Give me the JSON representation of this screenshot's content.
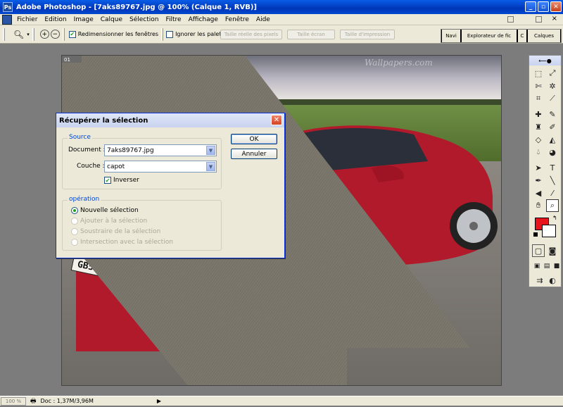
{
  "window": {
    "title": "Adobe Photoshop - [7aks89767.jpg @ 100% (Calque 1, RVB)]"
  },
  "menu": [
    "Fichier",
    "Edition",
    "Image",
    "Calque",
    "Sélection",
    "Filtre",
    "Affichage",
    "Fenêtre",
    "Aide"
  ],
  "options": {
    "zoom_dropdown_icon": "magnifier-icon",
    "resize_windows_label": "Redimensionner les fenêtres",
    "resize_windows_checked": true,
    "ignore_palettes_label": "Ignorer les palettes",
    "ignore_palettes_checked": false,
    "actual_pixels": "Taille réelle des pixels",
    "fit_screen": "Taille écran",
    "print_size": "Taille d'impression"
  },
  "palette_well": {
    "tab1": "Navi",
    "tab2": "Explorateur de fic",
    "tab3": "C",
    "tab4": "Calques"
  },
  "document": {
    "tag": "01",
    "watermark": "Wallpapers.com"
  },
  "dialog": {
    "title": "Récupérer la sélection",
    "source_legend": "Source",
    "document_label": "Document :",
    "document_value": "7aks89767.jpg",
    "channel_label": "Couche :",
    "channel_value": "capot",
    "invert_label": "Inverser",
    "invert_checked": true,
    "operation_legend": "opération",
    "op_new": "Nouvelle sélection",
    "op_add": "Ajouter à la sélection",
    "op_subtract": "Soustraire de la sélection",
    "op_intersect": "Intersection avec la sélection",
    "ok": "OK",
    "cancel": "Annuler"
  },
  "colors": {
    "foreground": "#e8141c",
    "background": "#ffffff",
    "titlebar": "#0a5de8"
  },
  "status": {
    "zoom": "100 %",
    "doc": "Doc : 1,37M/3,96M"
  }
}
